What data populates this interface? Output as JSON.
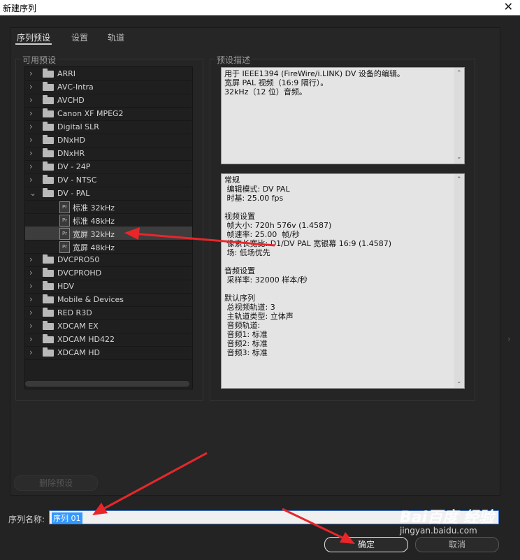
{
  "window": {
    "title": "新建序列",
    "close_glyph": "✕"
  },
  "tabs": [
    {
      "label": "序列预设"
    },
    {
      "label": "设置"
    },
    {
      "label": "轨道"
    }
  ],
  "available_presets": {
    "group_label": "可用预设",
    "items": [
      {
        "label": "ARRI",
        "type": "folder",
        "expanded": false
      },
      {
        "label": "AVC-Intra",
        "type": "folder",
        "expanded": false
      },
      {
        "label": "AVCHD",
        "type": "folder",
        "expanded": false
      },
      {
        "label": "Canon XF MPEG2",
        "type": "folder",
        "expanded": false
      },
      {
        "label": "Digital SLR",
        "type": "folder",
        "expanded": false
      },
      {
        "label": "DNxHD",
        "type": "folder",
        "expanded": false
      },
      {
        "label": "DNxHR",
        "type": "folder",
        "expanded": false
      },
      {
        "label": "DV - 24P",
        "type": "folder",
        "expanded": false
      },
      {
        "label": "DV - NTSC",
        "type": "folder",
        "expanded": false
      },
      {
        "label": "DV - PAL",
        "type": "folder",
        "expanded": true
      },
      {
        "label": "标准  32kHz",
        "type": "preset",
        "selected": false
      },
      {
        "label": "标准  48kHz",
        "type": "preset",
        "selected": false
      },
      {
        "label": "宽屏  32kHz",
        "type": "preset",
        "selected": true
      },
      {
        "label": "宽屏  48kHz",
        "type": "preset",
        "selected": false
      },
      {
        "label": "DVCPRO50",
        "type": "folder",
        "expanded": false
      },
      {
        "label": "DVCPROHD",
        "type": "folder",
        "expanded": false
      },
      {
        "label": "HDV",
        "type": "folder",
        "expanded": false
      },
      {
        "label": "Mobile & Devices",
        "type": "folder",
        "expanded": false
      },
      {
        "label": "RED R3D",
        "type": "folder",
        "expanded": false
      },
      {
        "label": "XDCAM EX",
        "type": "folder",
        "expanded": false
      },
      {
        "label": "XDCAM HD422",
        "type": "folder",
        "expanded": false
      },
      {
        "label": "XDCAM HD",
        "type": "folder",
        "expanded": false
      }
    ],
    "pr_badge": "Pr"
  },
  "preset_description": {
    "group_label": "预设描述",
    "description_lines": [
      "用于 IEEE1394 (FireWire/i.LINK) DV 设备的编辑。",
      "宽屏 PAL 视频（16:9 隔行）。",
      "32kHz（12 位）音频。"
    ],
    "details_lines": [
      "常规",
      " 编辑模式: DV PAL",
      " 时基: 25.00 fps",
      "",
      "视频设置",
      " 帧大小: 720h 576v (1.4587)",
      " 帧速率: 25.00  帧/秒",
      " 像素长宽比: D1/DV PAL 宽银幕 16:9 (1.4587)",
      " 场: 低场优先",
      "",
      "音频设置",
      " 采样率: 32000 样本/秒",
      "",
      "默认序列",
      " 总视频轨道: 3",
      " 主轨道类型: 立体声",
      " 音频轨道:",
      " 音频1: 标准",
      " 音频2: 标准",
      " 音频3: 标准"
    ]
  },
  "delete_preset_label": "删除预设",
  "sequence_name": {
    "label": "序列名称:",
    "value": "序列 01"
  },
  "buttons": {
    "ok": "确定",
    "cancel": "取消"
  },
  "watermark": {
    "brand": "Bai百度 经验",
    "url": "jingyan.baidu.com"
  },
  "colors": {
    "annotation_arrow": "#e8262a",
    "selection": "#3399ff"
  }
}
